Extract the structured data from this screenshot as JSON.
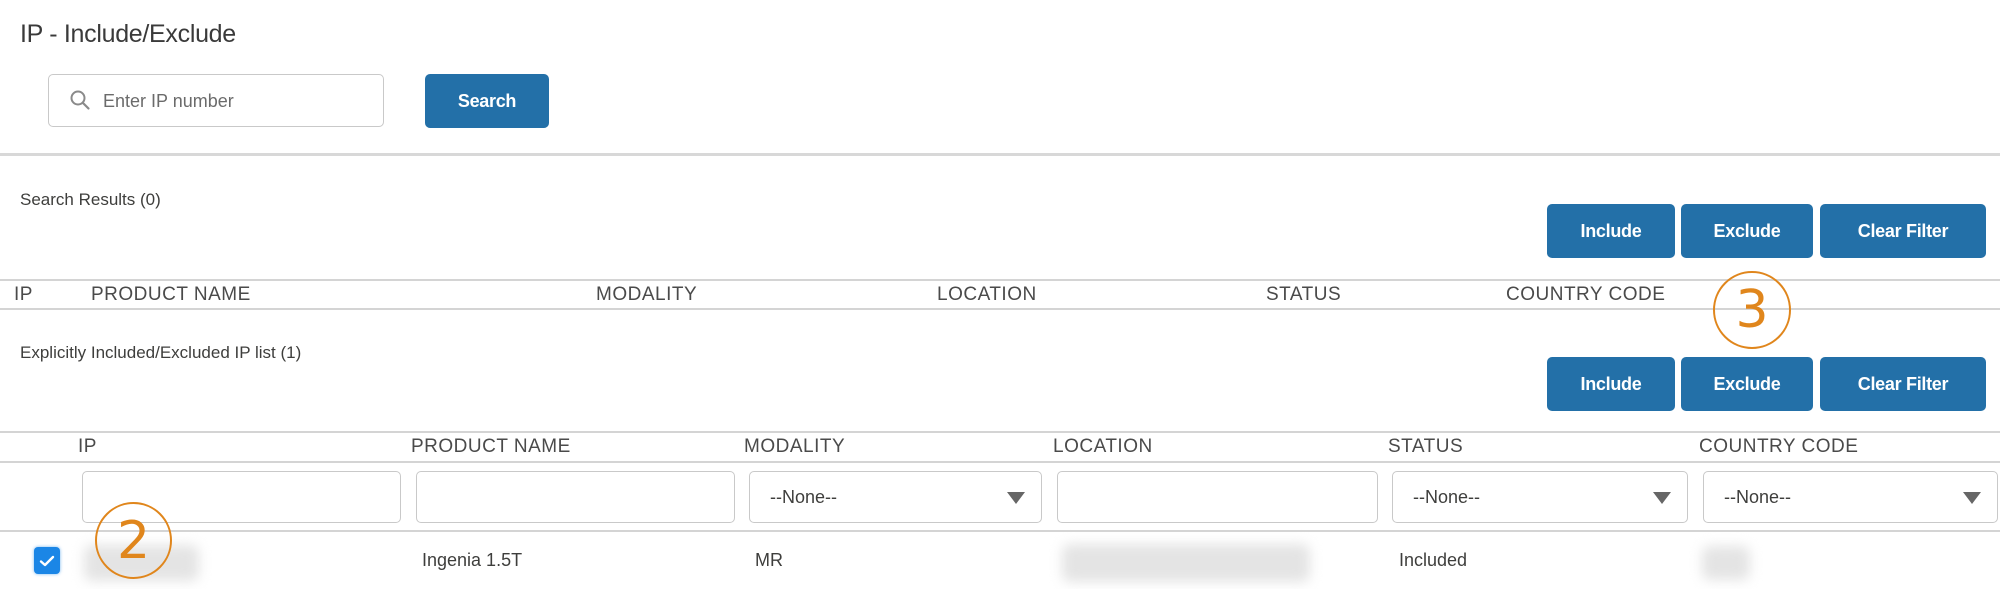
{
  "page": {
    "title": "IP - Include/Exclude"
  },
  "search": {
    "placeholder": "Enter IP number",
    "value": "",
    "button_label": "Search",
    "icon": "search-icon"
  },
  "search_results": {
    "label": "Search Results (0)",
    "actions": {
      "include": "Include",
      "exclude": "Exclude",
      "clear_filter": "Clear Filter"
    },
    "columns": [
      "IP",
      "PRODUCT NAME",
      "MODALITY",
      "LOCATION",
      "STATUS",
      "COUNTRY CODE"
    ],
    "rows": []
  },
  "explicit_list": {
    "label": "Explicitly Included/Excluded IP list (1)",
    "actions": {
      "include": "Include",
      "exclude": "Exclude",
      "clear_filter": "Clear Filter"
    },
    "columns": [
      "IP",
      "PRODUCT NAME",
      "MODALITY",
      "LOCATION",
      "STATUS",
      "COUNTRY CODE"
    ],
    "filters": {
      "ip": "",
      "product_name": "",
      "modality": "--None--",
      "location": "",
      "status": "--None--",
      "country_code": "--None--"
    },
    "rows": [
      {
        "selected": true,
        "ip": "[redacted]",
        "product_name": "Ingenia 1.5T",
        "modality": "MR",
        "location": "[redacted]",
        "status": "Included",
        "country_code": "[redacted]"
      }
    ]
  },
  "annotations": {
    "callout_2": "2",
    "callout_3": "3"
  },
  "colors": {
    "primary_button": "#2370a8",
    "checkbox": "#1b86e6",
    "callout": "#e0861c"
  }
}
